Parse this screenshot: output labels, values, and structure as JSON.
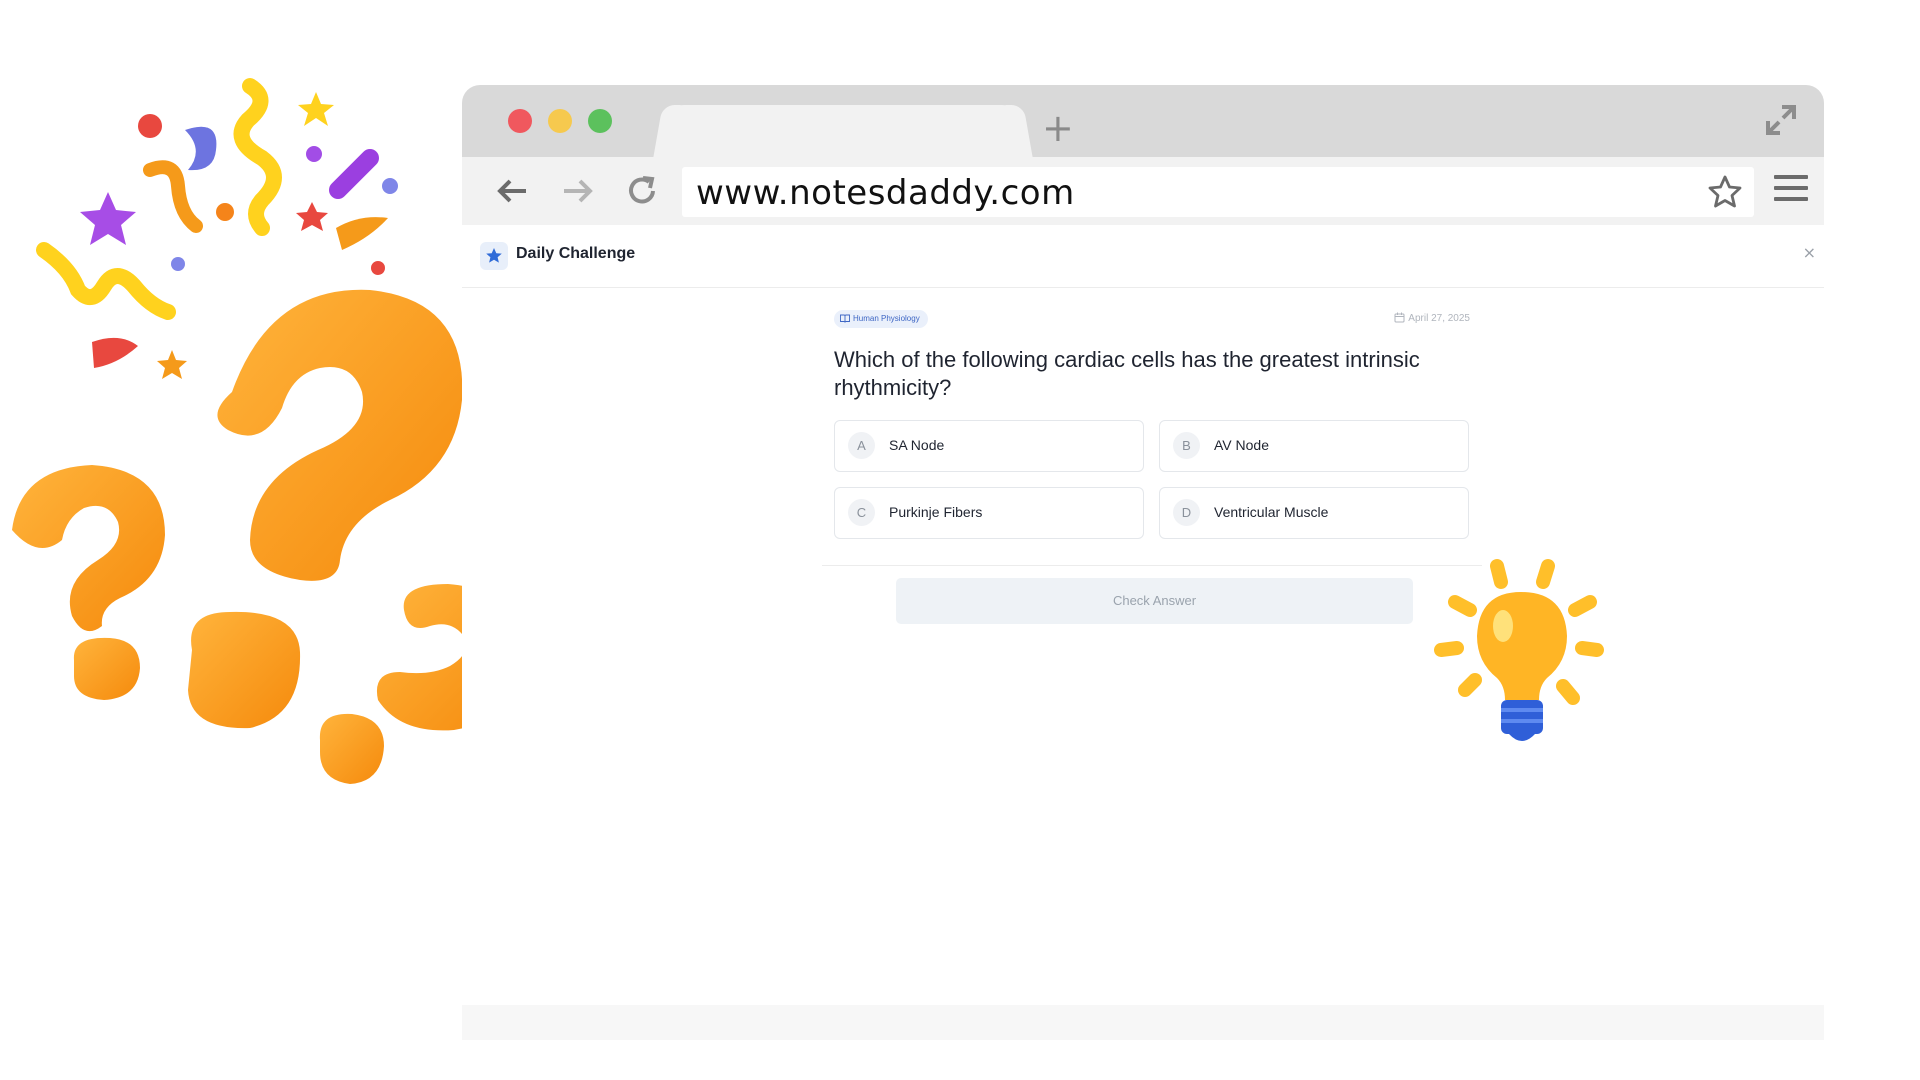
{
  "browser": {
    "url": "www.notesdaddy.com",
    "new_tab_symbol": "+",
    "icons": [
      "back-arrow-icon",
      "forward-arrow-icon",
      "reload-icon",
      "star-bookmark-icon",
      "hamburger-menu-icon",
      "expand-icon"
    ]
  },
  "app": {
    "title": "Daily Challenge",
    "close_symbol": "×",
    "accent_color": "#2f6bd8"
  },
  "question": {
    "topic": "Human Physiology",
    "date": "April 27, 2025",
    "text": "Which of the following cardiac cells has the greatest intrinsic rhythmicity?",
    "options": [
      {
        "letter": "A",
        "label": "SA Node"
      },
      {
        "letter": "B",
        "label": "AV Node"
      },
      {
        "letter": "C",
        "label": "Purkinje Fibers"
      },
      {
        "letter": "D",
        "label": "Ventricular Muscle"
      }
    ],
    "check_label": "Check Answer"
  },
  "decorations": {
    "left": "question-marks-and-confetti",
    "right": "lightbulb-icon",
    "question_mark_color": "#ff9a1c",
    "bulb_color": "#ffbf2a"
  }
}
